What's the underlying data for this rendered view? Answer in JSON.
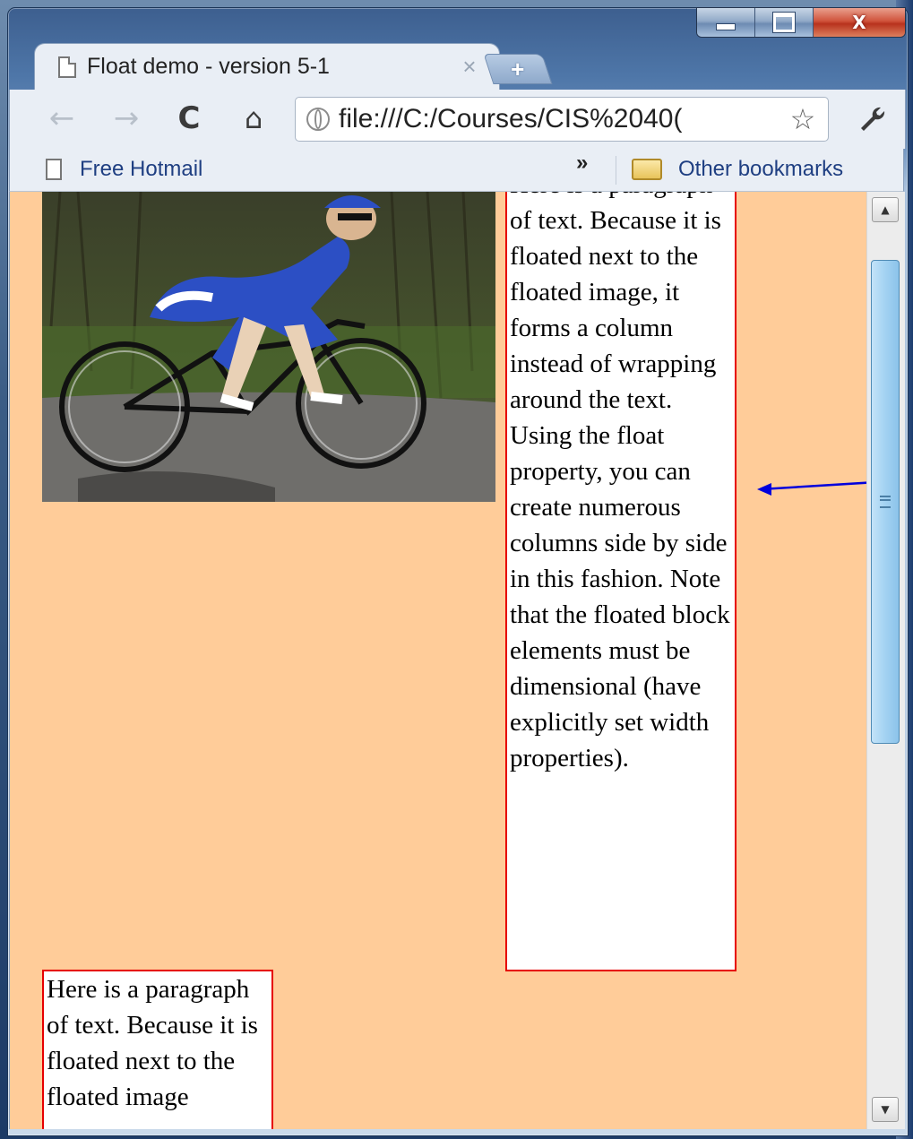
{
  "window": {
    "controls": {
      "minimize": "",
      "maximize": "",
      "close": "X"
    }
  },
  "tabs": [
    {
      "title": "Float demo - version 5-1",
      "close_glyph": "×",
      "active": true
    }
  ],
  "newtab_glyph": "+",
  "toolbar": {
    "back_glyph": "←",
    "forward_glyph": "→",
    "reload_glyph": "C",
    "home_glyph": "⌂",
    "address": "file:///C:/Courses/CIS%2040(",
    "star_glyph": "☆",
    "wrench_glyph": "🔧"
  },
  "bookmarks": {
    "items": [
      {
        "label": "Free Hotmail",
        "icon": "page-icon"
      }
    ],
    "overflow_glyph": "»",
    "other_label": "Other bookmarks"
  },
  "content": {
    "background": "#ffcc99",
    "border_color": "#e60000",
    "image_alt": "cyclist riding a road bike",
    "column1_text": "Here is a paragraph of text. Because it is floated next to the floated image, it forms a column instead of wrapping around the text. Using the float property, you can create numerous columns side by side in this fashion. Note that the floated block elements must be dimensional (have explicitly set width properties).",
    "column2_text": "Here is a paragraph of text. Because it is floated next to the floated image"
  },
  "annotation": {
    "color": "#0000dd",
    "icon": "arrow-left-icon"
  },
  "scrollbar": {
    "up_glyph": "▲",
    "down_glyph": "▼"
  }
}
